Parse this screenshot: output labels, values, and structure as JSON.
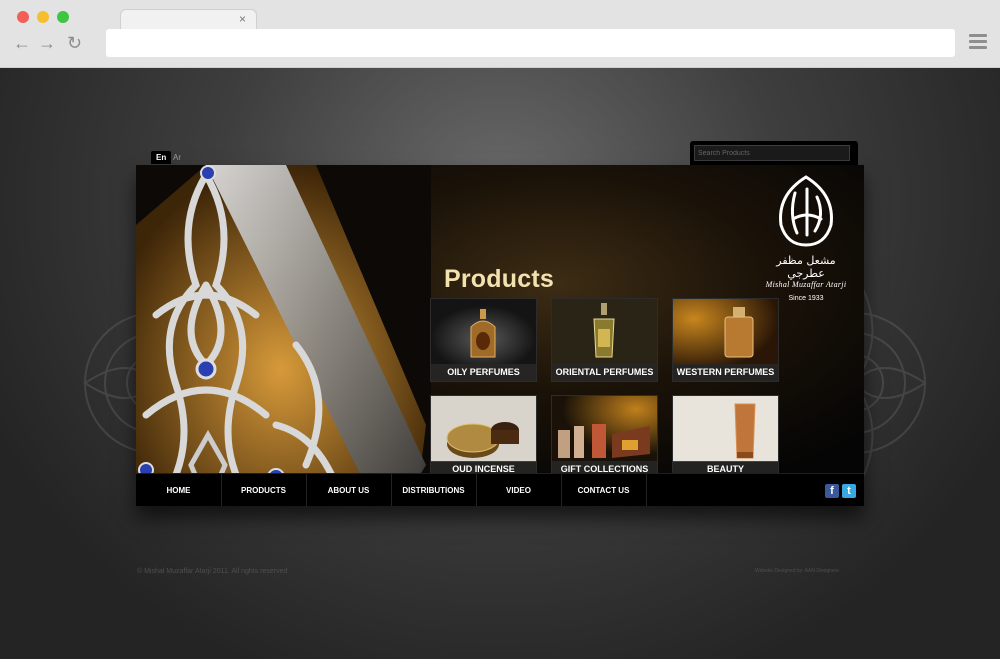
{
  "browser": {
    "tab_close": "×",
    "back_glyph": "←",
    "forward_glyph": "→",
    "reload_glyph": "↻"
  },
  "site": {
    "lang_en": "En",
    "lang_ar": "Ar",
    "search_placeholder": "Search Products",
    "page_heading": "Products",
    "logo": {
      "arabic": "مشعل مظفر عطرجي",
      "latin": "Mishal Muzaffar Atarji",
      "since": "Since 1933"
    },
    "products": [
      {
        "label": "OILY PERFUMES"
      },
      {
        "label": "ORIENTAL PERFUMES"
      },
      {
        "label": "WESTERN PERFUMES"
      },
      {
        "label": "OUD INCENSE"
      },
      {
        "label": "GIFT COLLECTIONS"
      },
      {
        "label": "BEAUTY"
      }
    ],
    "nav": [
      {
        "label": "HOME"
      },
      {
        "label": "PRODUCTS"
      },
      {
        "label": "ABOUT US"
      },
      {
        "label": "DISTRIBUTIONS"
      },
      {
        "label": "VIDEO"
      },
      {
        "label": "CONTACT US"
      }
    ],
    "social": {
      "facebook": "f",
      "twitter": "t"
    },
    "footer": {
      "copyright": "© Mishal Muzaffar Atarji 2011. All rights reserved",
      "credit": "Website Designed by: AAN Designers"
    }
  },
  "colors": {
    "title": "#f3e1b0",
    "facebook": "#3b5998",
    "twitter": "#3aa8e0"
  }
}
